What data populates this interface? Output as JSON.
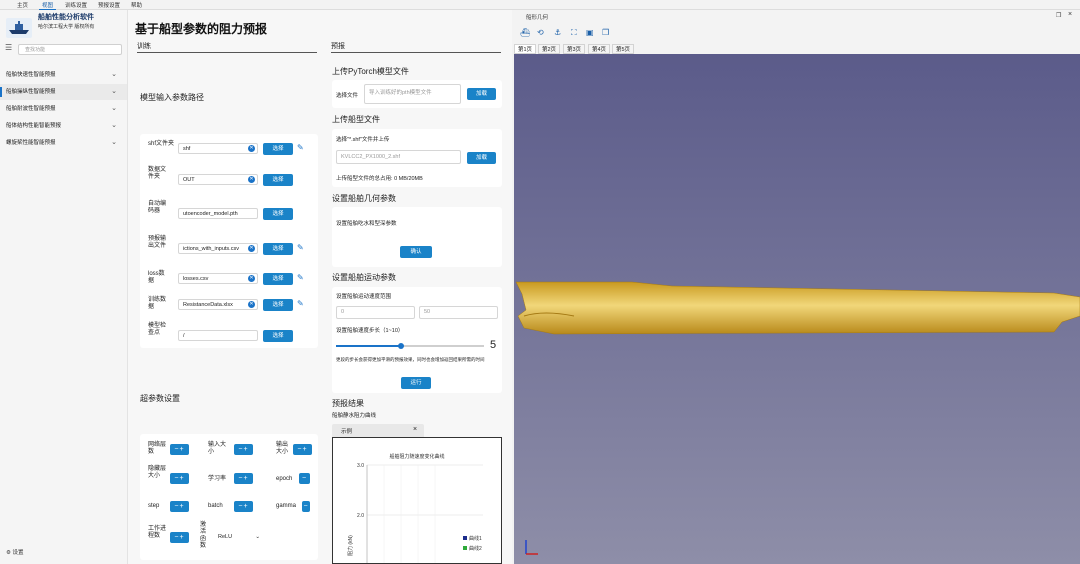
{
  "menubar": {
    "items": [
      "主页",
      "视图",
      "训练设置",
      "预报设置",
      "帮助"
    ],
    "active_index": 1
  },
  "sidebar": {
    "title": "船舶性能分析软件",
    "subtitle": "哈尔滨工程大学 版权所有",
    "search_placeholder": "查找功能",
    "items": [
      {
        "label": "船舶快速性智能预报"
      },
      {
        "label": "船舶操纵性智能预报"
      },
      {
        "label": "船舶耐波性智能预报"
      },
      {
        "label": "船体结构性能智能预报"
      },
      {
        "label": "螺旋桨性能智能预报"
      }
    ],
    "selected_index": 1,
    "settings_label": "设置"
  },
  "main": {
    "title": "基于船型参数的阻力预报",
    "train_header": "训练",
    "predict_header": "预报",
    "input_paths_title": "模型输入参数路径",
    "fields": [
      {
        "label": "shf文件夹",
        "value": "shf"
      },
      {
        "label": "数据文件夹",
        "value": "OUT"
      },
      {
        "label": "自动编码器",
        "value": "utoencoder_model.pth"
      },
      {
        "label": "预报输出文件",
        "value": "ictions_with_inputs.csv"
      },
      {
        "label": "loss数据",
        "value": "losses.csv"
      },
      {
        "label": "训练数据",
        "value": "ResistanceData.xlsx"
      },
      {
        "label": "模型检查点",
        "value": "/"
      }
    ],
    "select_label": "选择",
    "hyper_title": "超参数设置",
    "hyper_params": [
      {
        "label": "网络层数"
      },
      {
        "label": "输入大小"
      },
      {
        "label": "输出大小"
      },
      {
        "label": "隐藏层大小"
      },
      {
        "label": "学习率"
      },
      {
        "label": "epoch"
      },
      {
        "label": "step"
      },
      {
        "label": "batch"
      },
      {
        "label": "gamma"
      },
      {
        "label": "工作进程数"
      },
      {
        "label": "激活函数"
      }
    ],
    "activation_value": "ReLU",
    "upload_model_title": "上传PyTorch模型文件",
    "select_file_label": "选择文件",
    "pth_placeholder": "导入训练好的pth模型文件",
    "load_label": "加载",
    "upload_hull_title": "上传船型文件",
    "shf_hint": "选择\"*.shf\"文件并上传",
    "shf_placeholder": "KVLCC2_PX1000_2.shf",
    "hull_total_label": "上传船型文件的总占用",
    "hull_total_value": "0 MB/20MB",
    "geom_title": "设置船舶几何参数",
    "geom_sub": "设置船舶吃水和型深参数",
    "confirm_label": "确认",
    "motion_title": "设置船舶运动参数",
    "speed_range_label": "设置船舶运动速度范围",
    "speed_min": "0",
    "speed_max": "50",
    "step_label": "设置船舶速度步长（1~10）",
    "step_value": "5",
    "step_fraction": 0.44,
    "step_note": "更段的步长会获得更加平滑的预报效果，同时也会增加返回结果所需的时间",
    "run_label": "运行",
    "result_title": "预报结果",
    "result_sub": "船舶静水阻力曲线",
    "example_tab": "示例",
    "close_glyph": "×"
  },
  "chart_data": {
    "type": "line",
    "title": "船舶阻力随速度变化曲线",
    "ylabel": "阻力 (kN)",
    "yticks": [
      "3.0",
      "2.0"
    ],
    "series": [
      {
        "name": "曲线1",
        "color": "#1c2d8c"
      },
      {
        "name": "曲线2",
        "color": "#2eaa3a"
      }
    ]
  },
  "viewer": {
    "title": "船形几何",
    "tabs": [
      "第1页",
      "第2页",
      "第3页",
      "第4页",
      "第5页"
    ],
    "active_tab": 0,
    "toolbar_icons": [
      "ship-icon",
      "rotate-icon",
      "ship-view-icon",
      "fit-icon",
      "box-icon",
      "cube-icon"
    ],
    "hull_color": "#d9b23a",
    "background_color": "#6e6e98"
  }
}
